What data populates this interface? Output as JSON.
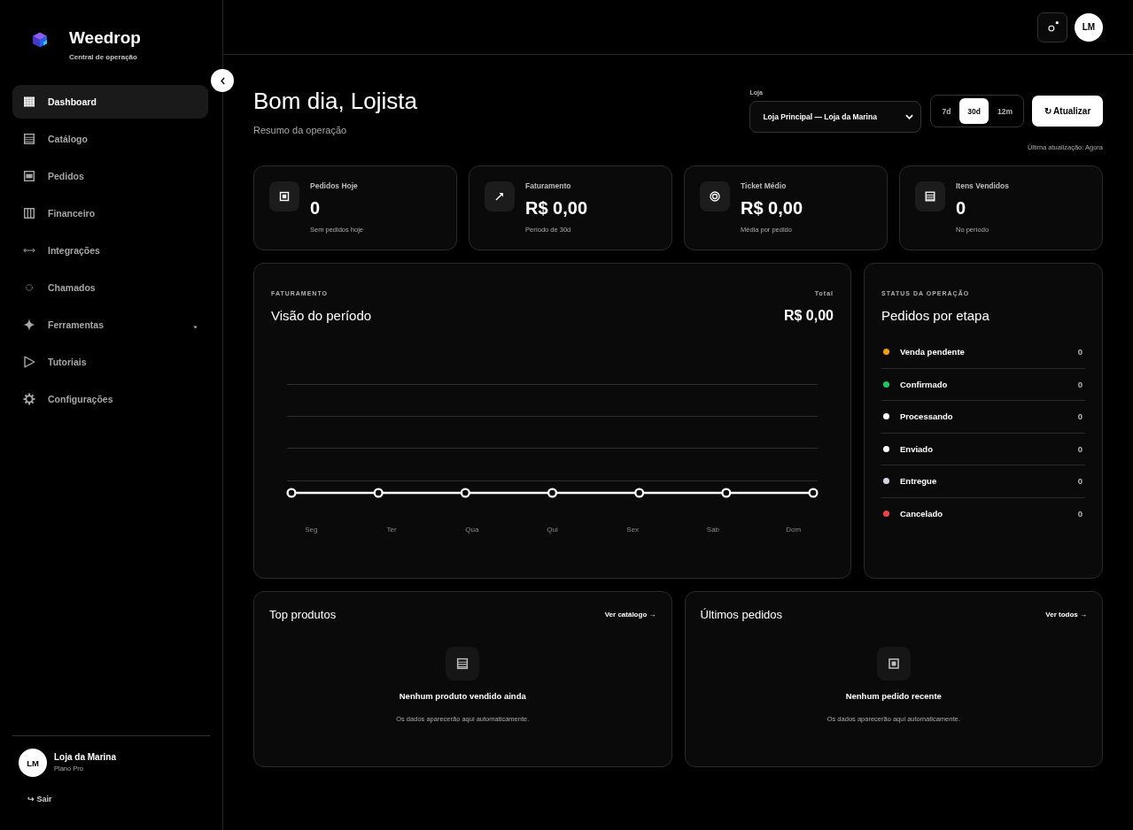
{
  "sidebar": {
    "brand": {
      "name": "Weedrop",
      "tagline": "Central de operação"
    },
    "nav": [
      {
        "label": "Dashboard",
        "selected": true,
        "kind": "link"
      },
      {
        "label": "Catálogo",
        "selected": false,
        "kind": "link"
      },
      {
        "label": "Pedidos",
        "selected": false,
        "kind": "link"
      },
      {
        "label": "Financeiro",
        "selected": false,
        "kind": "link"
      },
      {
        "label": "Integrações",
        "selected": false,
        "kind": "link"
      },
      {
        "label": "Chamados",
        "selected": false,
        "kind": "link"
      },
      {
        "label": "Ferramentas",
        "selected": false,
        "kind": "group"
      },
      {
        "label": "Tutoriais",
        "selected": false,
        "kind": "link"
      },
      {
        "label": "Configurações",
        "selected": false,
        "kind": "link"
      }
    ],
    "user": {
      "initials": "LM",
      "name": "Loja da Marina",
      "plan": "Plano Pro"
    },
    "logout": "↪ Sair"
  },
  "topbar": {
    "avatar": "LM"
  },
  "header": {
    "greeting": "Bom dia, Lojista",
    "subtitle": "Resumo da operação",
    "store": {
      "label": "Loja",
      "value": "Loja Principal — Loja da Marina"
    },
    "periods": [
      {
        "label": "7d",
        "selected": false
      },
      {
        "label": "30d",
        "selected": true
      },
      {
        "label": "12m",
        "selected": false
      }
    ],
    "refresh": "↻ Atualizar",
    "last_update": "Última atualização: Agora"
  },
  "stats": [
    {
      "label": "Pedidos Hoje",
      "value": "0",
      "note": "Sem pedidos hoje"
    },
    {
      "label": "Faturamento",
      "value": "R$ 0,00",
      "note": "Período de 30d"
    },
    {
      "label": "Ticket Médio",
      "value": "R$ 0,00",
      "note": "Média por pedido"
    },
    {
      "label": "Itens Vendidos",
      "value": "0",
      "note": "No período"
    }
  ],
  "revenue": {
    "eyebrow": "FATURAMENTO",
    "title": "Visão do período",
    "total_label": "Total",
    "total": "R$ 0,00",
    "day_labels": [
      "Seg",
      "Ter",
      "Qua",
      "Qui",
      "Sex",
      "Sáb",
      "Dom"
    ]
  },
  "status": {
    "eyebrow": "STATUS DA OPERAÇÃO",
    "title": "Pedidos por etapa",
    "stages": [
      {
        "label": "Venda pendente",
        "count": "0",
        "color": "#f59e0b"
      },
      {
        "label": "Confirmado",
        "count": "0",
        "color": "#22c55e"
      },
      {
        "label": "Processando",
        "count": "0",
        "color": "#ffffff"
      },
      {
        "label": "Enviado",
        "count": "0",
        "color": "#ffffff"
      },
      {
        "label": "Entregue",
        "count": "0",
        "color": "#d4d4e2"
      },
      {
        "label": "Cancelado",
        "count": "0",
        "color": "#ef4444"
      }
    ]
  },
  "panels": [
    {
      "title": "Top produtos",
      "link": "Ver catálogo →",
      "empty_title": "Nenhum produto vendido ainda",
      "empty_note": "Os dados aparecerão aqui automaticamente."
    },
    {
      "title": "Últimos pedidos",
      "link": "Ver todos →",
      "empty_title": "Nenhum pedido recente",
      "empty_note": "Os dados aparecerão aqui automaticamente."
    }
  ]
}
